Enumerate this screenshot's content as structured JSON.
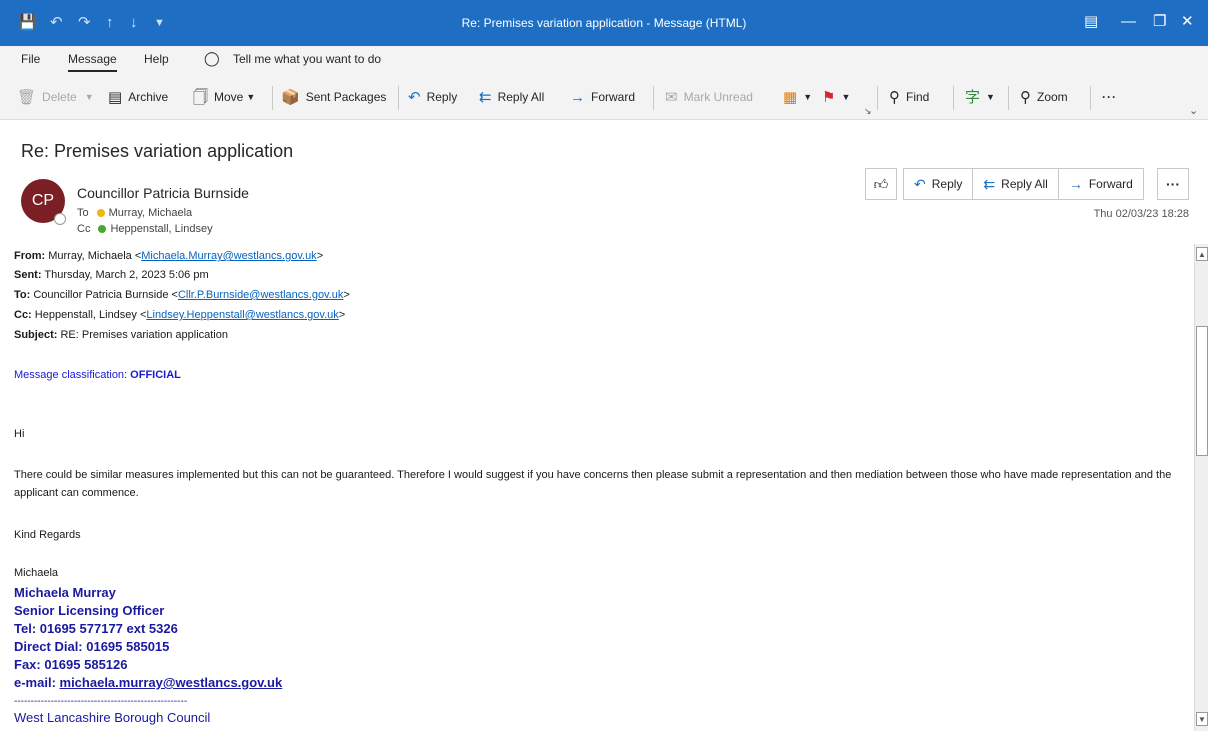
{
  "window": {
    "title": "Re: Premises variation application  -  Message (HTML)",
    "accent": "#1e6fc4"
  },
  "menu": {
    "file": "File",
    "message": "Message",
    "help": "Help",
    "tell_me": "Tell me what you want to do"
  },
  "ribbon": {
    "delete": "Delete",
    "archive": "Archive",
    "move": "Move",
    "sent_packages": "Sent Packages",
    "reply": "Reply",
    "reply_all": "Reply All",
    "forward": "Forward",
    "mark_unread": "Mark Unread",
    "find": "Find",
    "zoom": "Zoom",
    "more": "···"
  },
  "message": {
    "subject": "Re: Premises variation application",
    "avatar_initials": "CP",
    "avatar_color": "#7a1f24",
    "sender": "Councillor Patricia Burnside",
    "to_label": "To",
    "to": "Murray, Michaela",
    "cc_label": "Cc",
    "cc": "Heppenstall, Lindsey",
    "datetime": "Thu 02/03/23 18:28",
    "actions": {
      "reply": "Reply",
      "reply_all": "Reply All",
      "forward": "Forward",
      "more": "···"
    }
  },
  "body": {
    "from_label": "From:",
    "from_name": "Murray, Michaela <",
    "from_email": "Michaela.Murray@westlancs.gov.uk",
    "from_end": ">",
    "sent_label": "Sent:",
    "sent": "Thursday, March 2, 2023 5:06 pm",
    "to_label": "To:",
    "to_name": "Councillor Patricia Burnside <",
    "to_email": "Cllr.P.Burnside@westlancs.gov.uk",
    "to_end": ">",
    "cc_label": "Cc:",
    "cc_name": "Heppenstall, Lindsey <",
    "cc_email": "Lindsey.Heppenstall@westlancs.gov.uk",
    "cc_end": ">",
    "subject_label": "Subject:",
    "subject": "RE: Premises variation application",
    "classification_label": "Message classification: ",
    "classification": "OFFICIAL",
    "greeting": "Hi",
    "paragraph": "There could be similar measures implemented but this can not be guaranteed.  Therefore I would suggest if you have concerns then please submit a representation and then mediation between those who have made representation and the applicant can commence.",
    "closing": "Kind Regards",
    "first_name": "Michaela",
    "signature": {
      "name": "Michaela Murray",
      "role": "Senior Licensing Officer",
      "tel": "Tel: 01695 577177 ext 5326",
      "direct": "Direct Dial: 01695 585015",
      "fax": "Fax: 01695 585126",
      "email_label": "e-mail: ",
      "email": "michaela.murray@westlancs.gov.uk",
      "dashes": "----------------------------------------------------",
      "council": "West Lancashire Borough Council"
    }
  }
}
